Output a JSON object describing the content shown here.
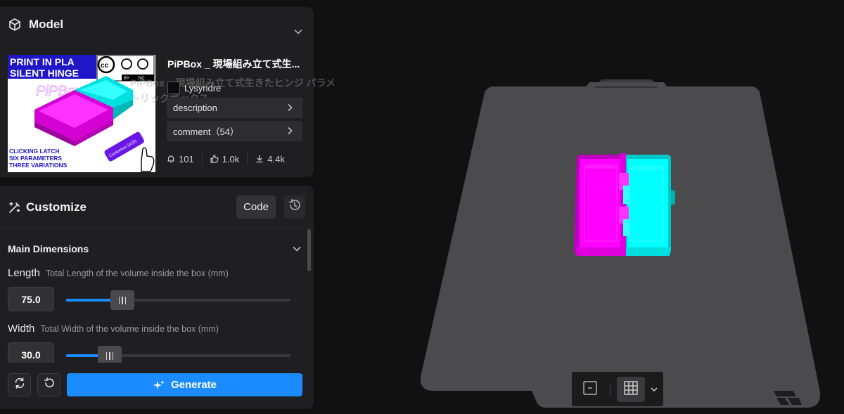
{
  "model": {
    "header_title": "Model",
    "title": "PiPBox _ 現場組み立て式生...",
    "title_ghost": "PiPBox _ 現場組み立て式生きたヒンジ パラメトリックボックス",
    "author": "Lysyndre",
    "description_label": "description",
    "comment_label": "comment（54）",
    "stats": {
      "notifications": "101",
      "likes": "1.0k",
      "downloads": "4.4k"
    },
    "thumbnail": {
      "line1": "PRINT IN PLA",
      "line2": "SILENT HINGE",
      "features": [
        "CLICKING LATCH",
        "SIX PARAMETERS",
        "THREE VARIATIONS"
      ],
      "badge": "Customize (#15)",
      "license": [
        "BY",
        "NC"
      ],
      "watermark": "PiPBox"
    }
  },
  "customize": {
    "header_title": "Customize",
    "code_label": "Code",
    "section_title": "Main Dimensions",
    "params": [
      {
        "name": "Length",
        "description": "Total Length of the volume inside the box (mm)",
        "value": "75.0",
        "slider_fraction": 0.25
      },
      {
        "name": "Width",
        "description": "Total Width of the volume inside the box (mm)",
        "value": "30.0",
        "slider_fraction": 0.195
      }
    ],
    "generate_label": "Generate"
  },
  "colors": {
    "accent": "#1a8cff",
    "panel_bg": "#1f1f21",
    "page_bg": "#111112",
    "bed": "#4a4a4c",
    "part_magenta": "#ff00ff",
    "part_cyan": "#00ffff"
  },
  "icons": {
    "model": "cube-icon",
    "customize": "magic-wand-icon",
    "history": "history-icon",
    "refresh": "refresh-icon",
    "undo": "undo-icon",
    "generate": "sparkle-icon",
    "view_minus": "minus-icon",
    "view_grid": "grid-icon"
  }
}
